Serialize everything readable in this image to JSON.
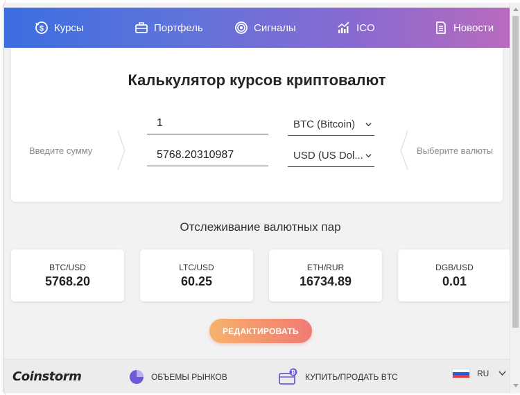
{
  "nav": {
    "items": [
      {
        "label": "Курсы",
        "icon": "exchange-icon"
      },
      {
        "label": "Портфель",
        "icon": "briefcase-icon"
      },
      {
        "label": "Сигналы",
        "icon": "target-icon"
      },
      {
        "label": "ICO",
        "icon": "chart-growth-icon"
      },
      {
        "label": "Новости",
        "icon": "document-icon"
      }
    ]
  },
  "calculator": {
    "title": "Калькулятор курсов криптовалют",
    "amount_hint": "Введите сумму",
    "currency_hint": "Выберите валюты",
    "amount_value": "1",
    "result_value": "5768.20310987",
    "from_currency": "BTC (Bitcoin)",
    "to_currency": "USD (US Dol..."
  },
  "tracking": {
    "title": "Отслеживание валютных пар",
    "pairs": [
      {
        "name": "BTC/USD",
        "value": "5768.20"
      },
      {
        "name": "LTC/USD",
        "value": "60.25"
      },
      {
        "name": "ETH/RUR",
        "value": "16734.89"
      },
      {
        "name": "DGB/USD",
        "value": "0.01"
      }
    ],
    "edit_label": "РЕДАКТИРОВАТЬ"
  },
  "footer": {
    "logo": "Coinstorm",
    "markets_label": "ОБЪЕМЫ РЫНКОВ",
    "buy_sell_label": "КУПИТЬ/ПРОДАТЬ BTC",
    "language": "RU"
  },
  "colors": {
    "nav_gradient_start": "#3d6ee0",
    "nav_gradient_end": "#b86bbd",
    "button_gradient_start": "#f7b26a",
    "button_gradient_end": "#f17a74",
    "accent_purple": "#6c5bd4"
  }
}
